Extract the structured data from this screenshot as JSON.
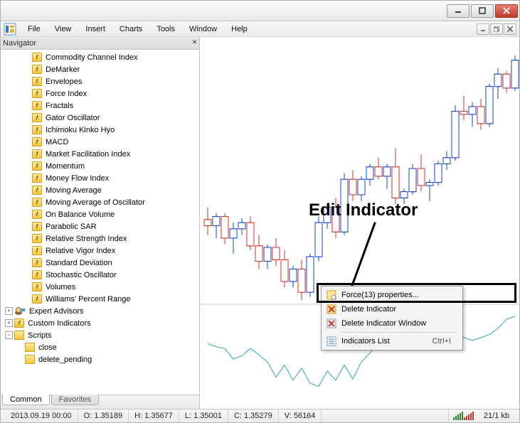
{
  "menus": [
    "File",
    "View",
    "Insert",
    "Charts",
    "Tools",
    "Window",
    "Help"
  ],
  "navigator": {
    "title": "Navigator",
    "indicators": [
      "Commodity Channel Index",
      "DeMarker",
      "Envelopes",
      "Force Index",
      "Fractals",
      "Gator Oscillator",
      "Ichimoku Kinko Hyo",
      "MACD",
      "Market Facilitation Index",
      "Momentum",
      "Money Flow Index",
      "Moving Average",
      "Moving Average of Oscillator",
      "On Balance Volume",
      "Parabolic SAR",
      "Relative Strength Index",
      "Relative Vigor Index",
      "Standard Deviation",
      "Stochastic Oscillator",
      "Volumes",
      "Williams' Percent Range"
    ],
    "sections": {
      "expert_advisors": "Expert Advisors",
      "custom_indicators": "Custom Indicators",
      "scripts": "Scripts",
      "script_items": [
        "close",
        "delete_pending"
      ]
    },
    "tabs": [
      "Common",
      "Favorites"
    ]
  },
  "annotation": "Edit Indicator",
  "context_menu": {
    "properties": "Force(13) properties...",
    "delete_indicator": "Delete Indicator",
    "delete_window": "Delete Indicator Window",
    "indicators_list": "Indicators List",
    "shortcut": "Ctrl+I"
  },
  "status": {
    "datetime": "2013.09.19 00:00",
    "open_label": "O:",
    "open": "1.35189",
    "high_label": "H:",
    "high": "1.35677",
    "low_label": "L:",
    "low": "1.35001",
    "close_label": "C:",
    "close": "1.35279",
    "vol_label": "V:",
    "vol": "56164",
    "transfer": "21/1 kb"
  },
  "chart_data": {
    "type": "candlestick+line",
    "main": {
      "type": "candlestick",
      "note": "candles estimated from pixels; date axis not labeled on screen",
      "candles": [
        {
          "i": 0,
          "o": 1.3522,
          "h": 1.353,
          "l": 1.3512,
          "c": 1.3518,
          "color": "red"
        },
        {
          "i": 1,
          "o": 1.3518,
          "h": 1.3526,
          "l": 1.351,
          "c": 1.3524,
          "color": "blue"
        },
        {
          "i": 2,
          "o": 1.3524,
          "h": 1.3526,
          "l": 1.3506,
          "c": 1.351,
          "color": "red"
        },
        {
          "i": 3,
          "o": 1.351,
          "h": 1.352,
          "l": 1.35,
          "c": 1.3516,
          "color": "blue"
        },
        {
          "i": 4,
          "o": 1.3516,
          "h": 1.3523,
          "l": 1.3512,
          "c": 1.352,
          "color": "blue"
        },
        {
          "i": 5,
          "o": 1.352,
          "h": 1.3524,
          "l": 1.3502,
          "c": 1.3505,
          "color": "red"
        },
        {
          "i": 6,
          "o": 1.3505,
          "h": 1.3512,
          "l": 1.349,
          "c": 1.3495,
          "color": "red"
        },
        {
          "i": 7,
          "o": 1.3495,
          "h": 1.3506,
          "l": 1.349,
          "c": 1.3504,
          "color": "blue"
        },
        {
          "i": 8,
          "o": 1.3504,
          "h": 1.351,
          "l": 1.3492,
          "c": 1.3496,
          "color": "red"
        },
        {
          "i": 9,
          "o": 1.3496,
          "h": 1.3502,
          "l": 1.3478,
          "c": 1.3482,
          "color": "red"
        },
        {
          "i": 10,
          "o": 1.3482,
          "h": 1.3492,
          "l": 1.3478,
          "c": 1.349,
          "color": "blue"
        },
        {
          "i": 11,
          "o": 1.349,
          "h": 1.3496,
          "l": 1.347,
          "c": 1.3475,
          "color": "red"
        },
        {
          "i": 12,
          "o": 1.3475,
          "h": 1.35,
          "l": 1.3472,
          "c": 1.3498,
          "color": "blue"
        },
        {
          "i": 13,
          "o": 1.3498,
          "h": 1.3524,
          "l": 1.3495,
          "c": 1.352,
          "color": "blue"
        },
        {
          "i": 14,
          "o": 1.352,
          "h": 1.3532,
          "l": 1.3516,
          "c": 1.353,
          "color": "blue"
        },
        {
          "i": 15,
          "o": 1.353,
          "h": 1.3536,
          "l": 1.351,
          "c": 1.3514,
          "color": "red"
        },
        {
          "i": 16,
          "o": 1.3514,
          "h": 1.3552,
          "l": 1.3512,
          "c": 1.3548,
          "color": "blue"
        },
        {
          "i": 17,
          "o": 1.3548,
          "h": 1.3554,
          "l": 1.3534,
          "c": 1.3538,
          "color": "red"
        },
        {
          "i": 18,
          "o": 1.3538,
          "h": 1.355,
          "l": 1.3534,
          "c": 1.3548,
          "color": "blue"
        },
        {
          "i": 19,
          "o": 1.3548,
          "h": 1.3558,
          "l": 1.3544,
          "c": 1.3556,
          "color": "blue"
        },
        {
          "i": 20,
          "o": 1.3556,
          "h": 1.3562,
          "l": 1.3548,
          "c": 1.355,
          "color": "red"
        },
        {
          "i": 21,
          "o": 1.355,
          "h": 1.3558,
          "l": 1.3542,
          "c": 1.3556,
          "color": "blue"
        },
        {
          "i": 22,
          "o": 1.3556,
          "h": 1.3568,
          "l": 1.3532,
          "c": 1.3536,
          "color": "red"
        },
        {
          "i": 23,
          "o": 1.3536,
          "h": 1.3542,
          "l": 1.3532,
          "c": 1.354,
          "color": "blue"
        },
        {
          "i": 24,
          "o": 1.354,
          "h": 1.3558,
          "l": 1.3538,
          "c": 1.3555,
          "color": "blue"
        },
        {
          "i": 25,
          "o": 1.3555,
          "h": 1.3564,
          "l": 1.354,
          "c": 1.3544,
          "color": "red"
        },
        {
          "i": 26,
          "o": 1.3544,
          "h": 1.3548,
          "l": 1.3534,
          "c": 1.3546,
          "color": "blue"
        },
        {
          "i": 27,
          "o": 1.3546,
          "h": 1.356,
          "l": 1.3544,
          "c": 1.3558,
          "color": "blue"
        },
        {
          "i": 28,
          "o": 1.3558,
          "h": 1.3566,
          "l": 1.3554,
          "c": 1.3562,
          "color": "blue"
        },
        {
          "i": 29,
          "o": 1.3562,
          "h": 1.3596,
          "l": 1.356,
          "c": 1.3592,
          "color": "blue"
        },
        {
          "i": 30,
          "o": 1.3592,
          "h": 1.3602,
          "l": 1.3586,
          "c": 1.359,
          "color": "red"
        },
        {
          "i": 31,
          "o": 1.359,
          "h": 1.3598,
          "l": 1.3582,
          "c": 1.3595,
          "color": "blue"
        },
        {
          "i": 32,
          "o": 1.3595,
          "h": 1.36,
          "l": 1.358,
          "c": 1.3584,
          "color": "red"
        },
        {
          "i": 33,
          "o": 1.3584,
          "h": 1.361,
          "l": 1.3582,
          "c": 1.3608,
          "color": "blue"
        },
        {
          "i": 34,
          "o": 1.3608,
          "h": 1.362,
          "l": 1.36,
          "c": 1.3616,
          "color": "blue"
        },
        {
          "i": 35,
          "o": 1.3616,
          "h": 1.3618,
          "l": 1.3604,
          "c": 1.3607,
          "color": "red"
        },
        {
          "i": 36,
          "o": 1.3607,
          "h": 1.3628,
          "l": 1.3605,
          "c": 1.3625,
          "color": "blue"
        }
      ],
      "ylim_est": [
        1.347,
        1.364
      ]
    },
    "sub": {
      "type": "line",
      "name": "Force(13)",
      "color": "#2aa7a7",
      "values_est": [
        0.1,
        0.05,
        0.02,
        -0.15,
        -0.1,
        0.02,
        -0.08,
        -0.2,
        -0.45,
        -0.25,
        -0.5,
        -0.3,
        -0.55,
        -0.6,
        -0.35,
        -0.5,
        -0.25,
        -0.48,
        -0.2,
        -0.05,
        0.1,
        0.4,
        0.55,
        0.35,
        0.15,
        0.6,
        0.4,
        0.3,
        0.35,
        0.3,
        0.2,
        0.15,
        0.2,
        0.25,
        0.35,
        0.5,
        0.55
      ],
      "ylim_est": [
        -0.7,
        0.7
      ]
    }
  }
}
